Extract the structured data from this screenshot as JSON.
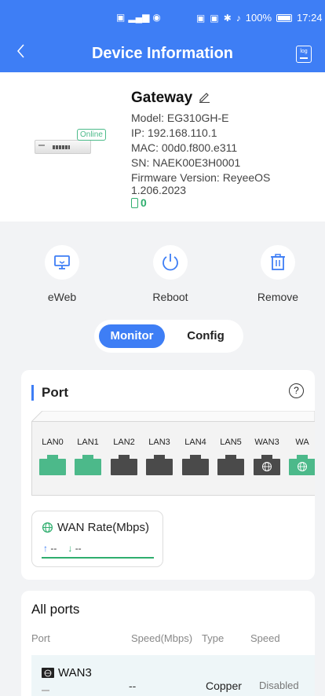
{
  "status_bar": {
    "battery": "100%",
    "time": "17:24"
  },
  "header": {
    "title": "Device Information",
    "back_icon": "chevron-left-icon",
    "log_label": "log"
  },
  "device": {
    "name": "Gateway",
    "status": "Online",
    "model": "Model: EG310GH-E",
    "ip": "IP:  192.168.110.1",
    "mac": "MAC:  00d0.f800.e311",
    "sn": "SN: NAEK00E3H0001",
    "firmware_line1": "Firmware Version: ReyeeOS",
    "firmware_line2": "1.206.2023",
    "client_count": "0"
  },
  "actions": [
    {
      "label": "eWeb",
      "icon": "monitor-icon"
    },
    {
      "label": "Reboot",
      "icon": "power-icon"
    },
    {
      "label": "Remove",
      "icon": "trash-icon"
    }
  ],
  "segment": {
    "active": "Monitor",
    "inactive": "Config"
  },
  "port_section": {
    "title": "Port",
    "help": "?",
    "ports": [
      {
        "label": "LAN0",
        "state": "up"
      },
      {
        "label": "LAN1",
        "state": "up"
      },
      {
        "label": "LAN2",
        "state": "down"
      },
      {
        "label": "LAN3",
        "state": "down"
      },
      {
        "label": "LAN4",
        "state": "down"
      },
      {
        "label": "LAN5",
        "state": "down"
      },
      {
        "label": "WAN3",
        "state": "down-wan"
      },
      {
        "label": "WA",
        "state": "up-wan"
      }
    ],
    "wan_rate": {
      "title": "WAN Rate(Mbps)",
      "up": "--",
      "down": "--"
    }
  },
  "all_ports": {
    "title": "All ports",
    "columns": [
      "Port",
      "Speed(Mbps)",
      "Type",
      "Speed"
    ],
    "rows": [
      {
        "port": "WAN3",
        "speed_mbps": "--",
        "type": "Copper",
        "speed": "Disabled"
      }
    ]
  },
  "colors": {
    "primary": "#3e7ef5",
    "online": "#4cbb8a",
    "port_up": "#4cb98a",
    "port_down": "#4a4a4a"
  }
}
